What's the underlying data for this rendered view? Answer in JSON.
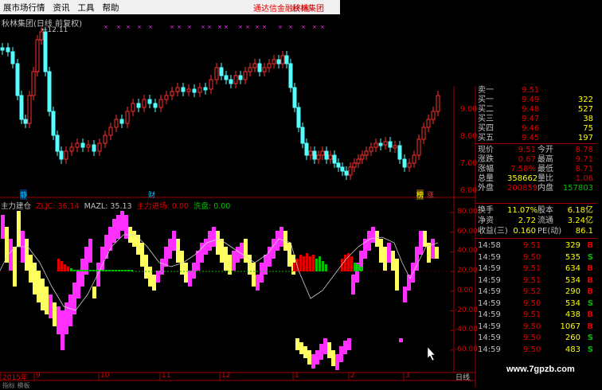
{
  "menu": {
    "items": [
      "展市场行情",
      "资讯",
      "工具",
      "帮助"
    ],
    "notice": "通达信金融终端",
    "stock_name": "秋林集团"
  },
  "main_chart": {
    "title": "秋林集团(日线 前复权)",
    "high_label": "12.11",
    "yaxis": [
      "9.00",
      "8.00",
      "7.00",
      "6.00"
    ],
    "markers": [
      "静",
      "财",
      "榜",
      "涨"
    ]
  },
  "indicator": {
    "labels": [
      {
        "text": "主力建仓",
        "color": "#c0c0c0"
      },
      {
        "text": "ZLJC: 36.14",
        "color": "#e00000"
      },
      {
        "text": "MAZL: 35.13",
        "color": "#c0c0c0"
      },
      {
        "text": "主力进场: 0.00",
        "color": "#e00000"
      },
      {
        "text": "洗盘: 0.00",
        "color": "#00c000"
      }
    ],
    "yaxis": [
      "80.00",
      "60.00",
      "40.00",
      "20.00",
      "0.00",
      "-20.00",
      "-40.00",
      "-60.00"
    ]
  },
  "timeline": {
    "labels": [
      "2015年",
      "9",
      "10",
      "11",
      "12",
      "1",
      "2",
      "3",
      "日线"
    ]
  },
  "bottom_strip": [
    "指标",
    "模板"
  ],
  "order_book": [
    {
      "label": "卖一",
      "price": "9.51",
      "vol": "",
      "pc": "#e00000",
      "vc": "#ffff00"
    },
    {
      "label": "买一",
      "price": "9.49",
      "vol": "322",
      "pc": "#e00000",
      "vc": "#ffff00"
    },
    {
      "label": "买二",
      "price": "9.48",
      "vol": "527",
      "pc": "#e00000",
      "vc": "#ffff00"
    },
    {
      "label": "买三",
      "price": "9.47",
      "vol": "38",
      "pc": "#e00000",
      "vc": "#ffff00"
    },
    {
      "label": "买四",
      "price": "9.46",
      "vol": "75",
      "pc": "#e00000",
      "vc": "#ffff00"
    },
    {
      "label": "买五",
      "price": "9.45",
      "vol": "197",
      "pc": "#e00000",
      "vc": "#ffff00"
    }
  ],
  "stats_block1": [
    {
      "l1": "现价",
      "v1": "9.51",
      "c1": "#e00000",
      "l2": "今开",
      "v2": "8.78",
      "c2": "#e00000"
    },
    {
      "l1": "涨跌",
      "v1": "0.67",
      "c1": "#e00000",
      "l2": "最高",
      "v2": "9.71",
      "c2": "#e00000"
    },
    {
      "l1": "涨幅",
      "v1": "7.58%",
      "c1": "#e00000",
      "l2": "最低",
      "v2": "8.71",
      "c2": "#e00000"
    },
    {
      "l1": "总量",
      "v1": "358662",
      "c1": "#ffff00",
      "l2": "量比",
      "v2": "1.06",
      "c2": "#e00000"
    },
    {
      "l1": "外盘",
      "v1": "200859",
      "c1": "#e00000",
      "l2": "内盘",
      "v2": "157803",
      "c2": "#00c000"
    }
  ],
  "stats_block2": [
    {
      "l1": "换手",
      "v1": "11.07%",
      "c1": "#ffff00",
      "l2": "股本",
      "v2": "6.18亿",
      "c2": "#ffff00"
    },
    {
      "l1": "净资",
      "v1": "2.72",
      "c1": "#ffff00",
      "l2": "流通",
      "v2": "3.24亿",
      "c2": "#ffff00"
    },
    {
      "l1": "收益(三)",
      "v1": "0.160",
      "c1": "#ffff00",
      "l2": "PE(动)",
      "v2": "86.1",
      "c2": "#ffff00"
    }
  ],
  "trades": [
    {
      "time": "14:58",
      "price": "9.51",
      "vol": "329",
      "side": "B",
      "sc": "#e00000"
    },
    {
      "time": "14:59",
      "price": "9.50",
      "vol": "535",
      "side": "S",
      "sc": "#00c000"
    },
    {
      "time": "14:59",
      "price": "9.51",
      "vol": "634",
      "side": "B",
      "sc": "#e00000"
    },
    {
      "time": "14:59",
      "price": "9.51",
      "vol": "534",
      "side": "B",
      "sc": "#e00000"
    },
    {
      "time": "14:59",
      "price": "9.52",
      "vol": "290",
      "side": "B",
      "sc": "#e00000"
    },
    {
      "time": "14:59",
      "price": "9.50",
      "vol": "534",
      "side": "S",
      "sc": "#00c000"
    },
    {
      "time": "14:59",
      "price": "9.51",
      "vol": "438",
      "side": "B",
      "sc": "#e00000"
    },
    {
      "time": "14:59",
      "price": "9.50",
      "vol": "1067",
      "side": "B",
      "sc": "#e00000"
    },
    {
      "time": "14:59",
      "price": "9.50",
      "vol": "260",
      "side": "S",
      "sc": "#00c000"
    },
    {
      "time": "14:59",
      "price": "9.50",
      "vol": "483",
      "side": "S",
      "sc": "#00c000"
    }
  ],
  "watermark": "www.7gpzb.com",
  "colors": {
    "up": "#ff3030",
    "down": "#54ffff",
    "magenta": "#ff30ff",
    "yellow": "#ffff60",
    "green": "#00c000",
    "red": "#e00000",
    "grid": "#a00000"
  }
}
